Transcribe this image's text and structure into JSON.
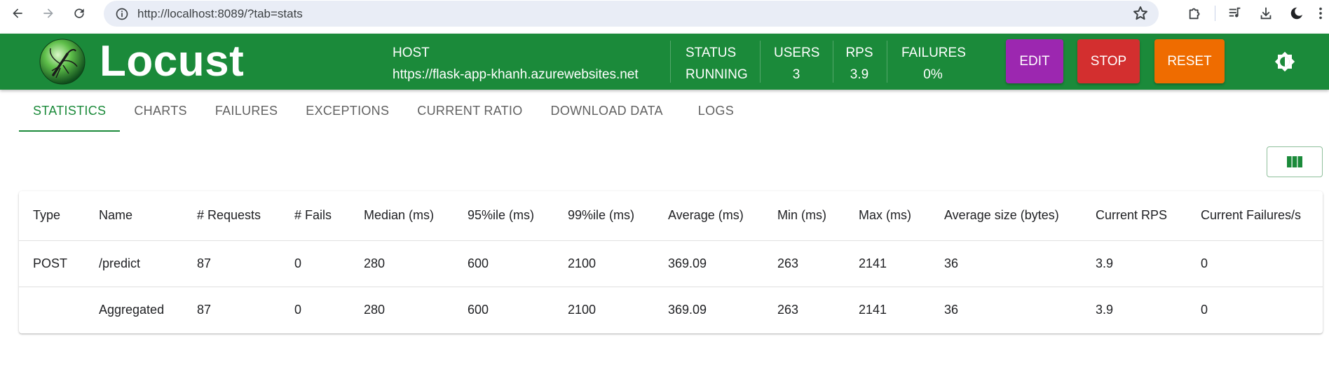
{
  "browser": {
    "url": "http://localhost:8089/?tab=stats"
  },
  "header": {
    "brand": "Locust",
    "host": {
      "label": "HOST",
      "value": "https://flask-app-khanh.azurewebsites.net"
    },
    "status": {
      "label": "STATUS",
      "value": "RUNNING"
    },
    "users": {
      "label": "USERS",
      "value": "3"
    },
    "rps": {
      "label": "RPS",
      "value": "3.9"
    },
    "failures": {
      "label": "FAILURES",
      "value": "0%"
    },
    "buttons": {
      "edit": "EDIT",
      "stop": "STOP",
      "reset": "RESET"
    },
    "colors": {
      "bar": "#1b8a3a",
      "edit": "#9c27b0",
      "stop": "#d32f2f",
      "reset": "#ef6c00"
    }
  },
  "tabs": [
    {
      "label": "STATISTICS",
      "active": true
    },
    {
      "label": "CHARTS"
    },
    {
      "label": "FAILURES"
    },
    {
      "label": "EXCEPTIONS"
    },
    {
      "label": "CURRENT RATIO"
    },
    {
      "label": "DOWNLOAD DATA"
    },
    {
      "label": "LOGS"
    }
  ],
  "table": {
    "columns": [
      "Type",
      "Name",
      "# Requests",
      "# Fails",
      "Median (ms)",
      "95%ile (ms)",
      "99%ile (ms)",
      "Average (ms)",
      "Min (ms)",
      "Max (ms)",
      "Average size (bytes)",
      "Current RPS",
      "Current Failures/s"
    ],
    "rows": [
      [
        "POST",
        "/predict",
        "87",
        "0",
        "280",
        "600",
        "2100",
        "369.09",
        "263",
        "2141",
        "36",
        "3.9",
        "0"
      ],
      [
        "",
        "Aggregated",
        "87",
        "0",
        "280",
        "600",
        "2100",
        "369.09",
        "263",
        "2141",
        "36",
        "3.9",
        "0"
      ]
    ]
  },
  "icons": {
    "back": "arrow-left-icon",
    "forward": "arrow-right-icon",
    "reload": "reload-icon",
    "site_info": "tune-icon",
    "bookmark": "star-icon",
    "extensions": "puzzle-icon",
    "media": "playlist-icon",
    "downloads": "download-icon",
    "profile": "moon-icon",
    "menu": "kebab-icon",
    "theme": "brightness-icon",
    "columns": "view-column-icon"
  }
}
